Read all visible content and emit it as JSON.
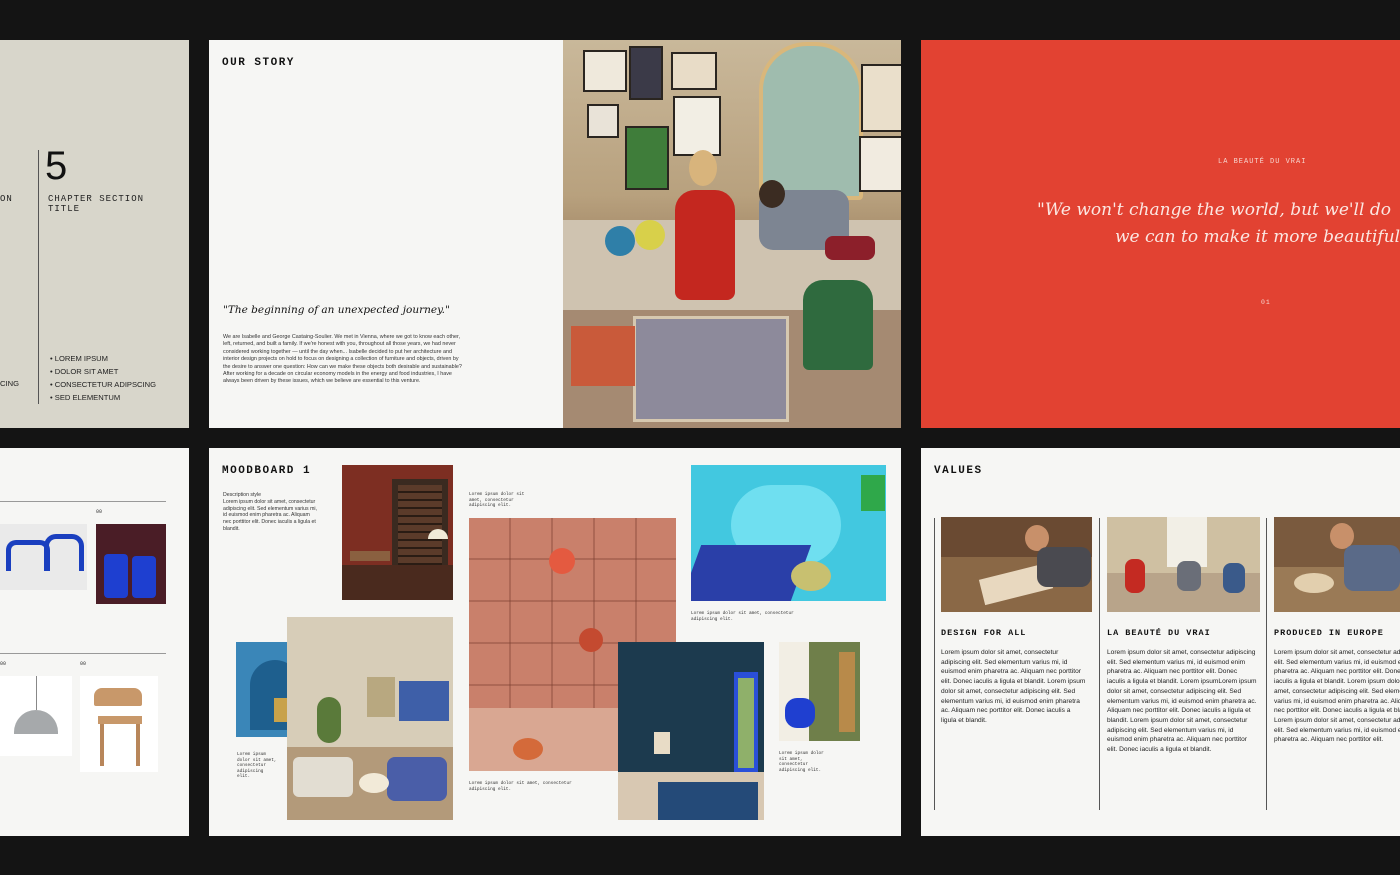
{
  "chapter": {
    "number": "5",
    "partial_label": "ON",
    "title": "CHAPTER SECTION TITLE",
    "partial_left_item": "CING",
    "items": [
      "LOREM IPSUM",
      "DOLOR SIT AMET",
      "CONSECTETUR ADIPSCING",
      "SED ELEMENTUM"
    ]
  },
  "story": {
    "heading": "OUR STORY",
    "quote": "\"The beginning of an unexpected journey.\"",
    "body": "We are Isabelle and George Castaing-Soulier. We met in Vienna, where we got to know each other, left, returned, and built a family. If we're honest with you, throughout all those years, we had never considered working together — until the day when... Isabelle decided to put her architecture and interior design projects on hold to focus on designing a collection of furniture and objects, driven by the desire to answer one question: How can we make these objects both desirable and sustainable? After working for a decade on circular economy models in the energy and food industries, I have always been driven by these issues, which we believe are essential to this venture."
  },
  "quote_slide": {
    "label": "LA BEAUTÉ DU VRAI",
    "quote_line1": "\"We won't change the world, but we'll do",
    "quote_line2": "we can to make it more beautiful",
    "page": "01"
  },
  "products": {
    "label_1": "00",
    "label_2": "00",
    "label_3": "00"
  },
  "moodboard": {
    "title": "MOODBOARD 1",
    "description": "Description style\nLorem ipsum dolor sit amet, consectetur adipiscing elit. Sed elementum varius mi, id euismod enim pharetra ac. Aliquam nec porttitor elit. Donec iaculis a ligula et blandit.",
    "caption_a": "Lorem ipsum dolor sit amet, consectetur adipiscing elit.",
    "caption_b": "Lorem ipsum dolor sit amet, consectetur adipiscing elit.",
    "caption_c": "Lorem ipsum dolor sit amet, consectetur adipiscing elit.",
    "caption_d": "Lorem ipsum dolor sit amet, consectetur adipiscing elit.",
    "caption_e": "Lorem ipsum dolor sit amet, consectetur adipiscing elit."
  },
  "values": {
    "title": "VALUES",
    "columns": [
      {
        "heading": "DESIGN FOR ALL",
        "text": "Lorem ipsum dolor sit amet, consectetur adipiscing elit. Sed elementum varius mi, id euismod enim pharetra ac. Aliquam nec porttitor elit. Donec iaculis a ligula et blandit. Lorem ipsum dolor sit amet, consectetur adipiscing elit. Sed elementum varius mi, id euismod enim pharetra ac. Aliquam nec porttitor elit. Donec iaculis a ligula et blandit."
      },
      {
        "heading": "LA BEAUTÉ DU VRAI",
        "text": "Lorem ipsum dolor sit amet, consectetur adipiscing elit. Sed elementum varius mi, id euismod enim pharetra ac. Aliquam nec porttitor elit. Donec iaculis a ligula et blandit. Lorem ipsumLorem ipsum dolor sit amet, consectetur adipiscing elit. Sed elementum varius mi, id euismod enim pharetra ac. Aliquam nec porttitor elit. Donec iaculis a ligula et blandit. Lorem ipsum dolor sit amet, consectetur adipiscing elit. Sed elementum varius mi, id euismod enim pharetra ac. Aliquam nec porttitor elit. Donec iaculis a ligula et blandit."
      },
      {
        "heading": "PRODUCED IN EUROPE",
        "text": "Lorem ipsum dolor sit amet, consectetur adipiscing elit. Sed elementum varius mi, id euismod enim pharetra ac. Aliquam nec porttitor elit. Donec iaculis a ligula et blandit. Lorem ipsum dolor sit amet, consectetur adipiscing elit. Sed elementum varius mi, id euismod enim pharetra ac. Aliquam nec porttitor elit. Donec iaculis a ligula et blandit. Lorem ipsum dolor sit amet, consectetur adipiscing elit. Sed elementum varius mi, id euismod enim pharetra ac. Aliquam nec porttitor elit."
      }
    ]
  },
  "colors": {
    "background": "#141414",
    "beige": "#d8d6cb",
    "red": "#e24232",
    "paper": "#f6f6f4"
  }
}
